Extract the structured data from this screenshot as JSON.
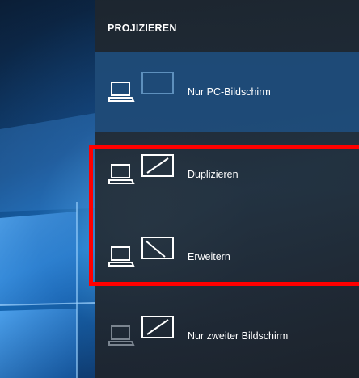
{
  "panel": {
    "title": "PROJIZIEREN",
    "options": [
      {
        "label": "Nur PC-Bildschirm",
        "icon": "pc-screen-only-icon",
        "selected": true
      },
      {
        "label": "Duplizieren",
        "icon": "duplicate-icon",
        "selected": false
      },
      {
        "label": "Erweitern",
        "icon": "extend-icon",
        "selected": false
      },
      {
        "label": "Nur zweiter Bildschirm",
        "icon": "second-screen-only-icon",
        "selected": false
      }
    ]
  },
  "colors": {
    "panel_bg": "#242c34",
    "selected_bg": "#1e5082",
    "highlight": "#ff0000",
    "text": "#ffffff"
  }
}
